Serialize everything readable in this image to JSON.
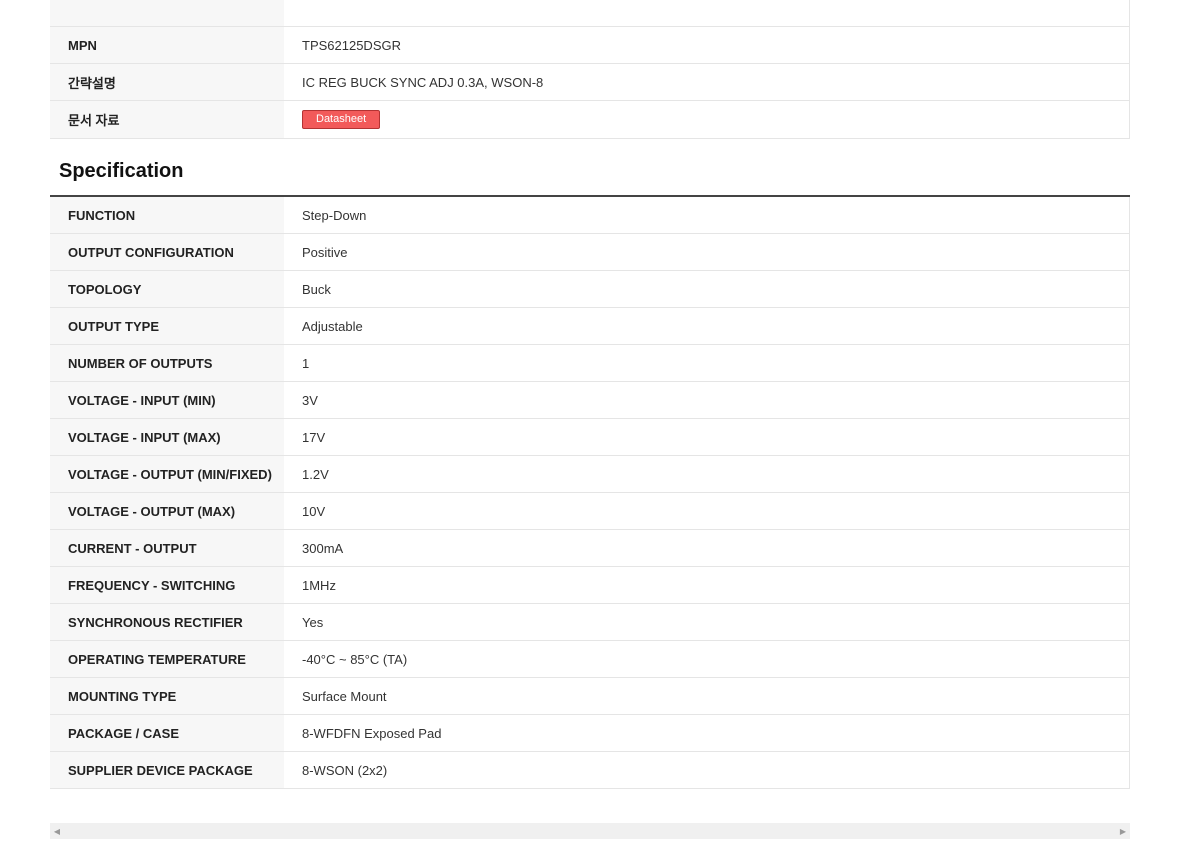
{
  "info": {
    "rows": [
      {
        "label": "MPN",
        "value": "TPS62125DSGR"
      },
      {
        "label": "간략설명",
        "value": "IC REG BUCK SYNC ADJ 0.3A, WSON-8"
      }
    ],
    "document_label": "문서 자료",
    "datasheet_button": "Datasheet"
  },
  "specification": {
    "title": "Specification",
    "rows": [
      {
        "label": "FUNCTION",
        "value": "Step-Down"
      },
      {
        "label": "OUTPUT CONFIGURATION",
        "value": "Positive"
      },
      {
        "label": "TOPOLOGY",
        "value": "Buck"
      },
      {
        "label": "OUTPUT TYPE",
        "value": "Adjustable"
      },
      {
        "label": "NUMBER OF OUTPUTS",
        "value": "1"
      },
      {
        "label": "VOLTAGE - INPUT (MIN)",
        "value": "3V"
      },
      {
        "label": "VOLTAGE - INPUT (MAX)",
        "value": "17V"
      },
      {
        "label": "VOLTAGE - OUTPUT (MIN/FIXED)",
        "value": "1.2V"
      },
      {
        "label": "VOLTAGE - OUTPUT (MAX)",
        "value": "10V"
      },
      {
        "label": "CURRENT - OUTPUT",
        "value": "300mA"
      },
      {
        "label": "FREQUENCY - SWITCHING",
        "value": "1MHz"
      },
      {
        "label": "SYNCHRONOUS RECTIFIER",
        "value": "Yes"
      },
      {
        "label": "OPERATING TEMPERATURE",
        "value": "-40°C ~ 85°C (TA)"
      },
      {
        "label": "MOUNTING TYPE",
        "value": "Surface Mount"
      },
      {
        "label": "PACKAGE / CASE",
        "value": "8-WFDFN Exposed Pad"
      },
      {
        "label": "SUPPLIER DEVICE PACKAGE",
        "value": "8-WSON (2x2)"
      }
    ]
  },
  "scrollbar": {
    "left_arrow": "◀",
    "right_arrow": "▶"
  }
}
